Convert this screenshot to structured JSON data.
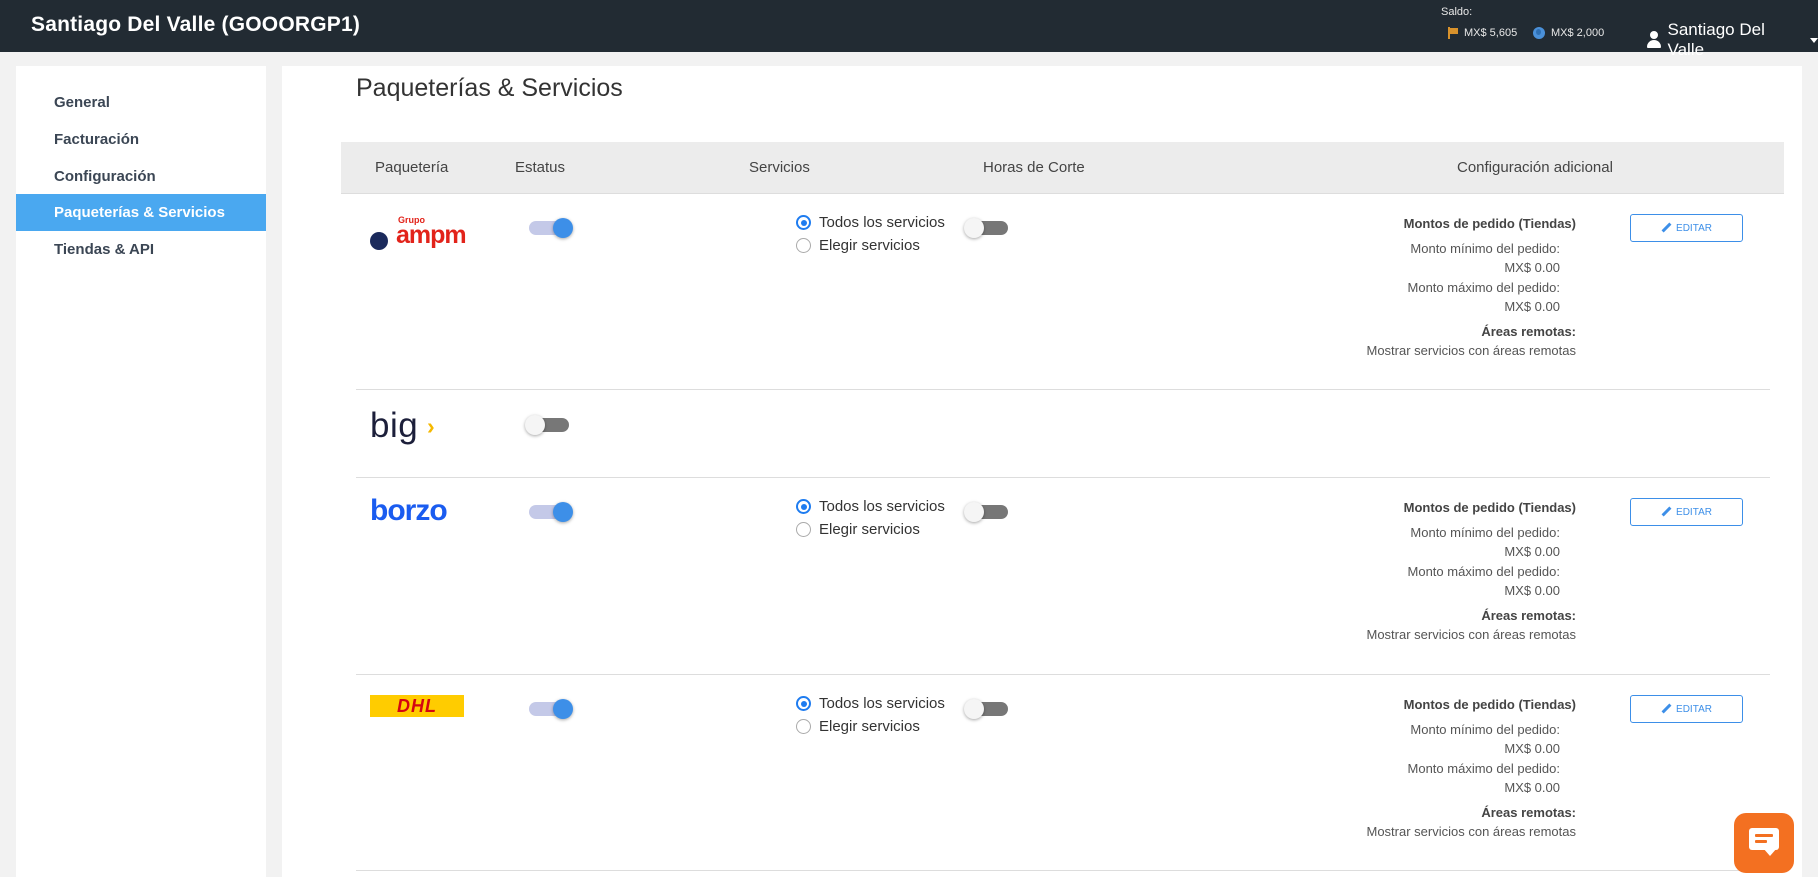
{
  "header": {
    "title": "Santiago Del Valle (GOOORGP1)",
    "saldo_label": "Saldo:",
    "balance_primary": "MX$ 5,605",
    "balance_secondary": "MX$ 2,000",
    "user_name": "Santiago Del Valle"
  },
  "sidebar": {
    "items": [
      {
        "label": "General"
      },
      {
        "label": "Facturación"
      },
      {
        "label": "Configuración"
      },
      {
        "label": "Paqueterías & Servicios"
      },
      {
        "label": "Tiendas & API"
      }
    ],
    "active_index": 3
  },
  "page": {
    "title": "Paqueterías & Servicios",
    "columns": [
      "Paquetería",
      "Estatus",
      "Servicios",
      "Horas de Corte",
      "Configuración adicional"
    ]
  },
  "carriers": [
    {
      "name": "Grupo ampm",
      "logo_text_top": "Grupo",
      "logo_text": "ampm",
      "status_on": true,
      "radio_all": "Todos los servicios",
      "radio_choose": "Elegir servicios",
      "cutoff_on": false,
      "cfg_title": "Montos de pedido (Tiendas)",
      "min_label": "Monto mínimo del pedido:",
      "min_value": "MX$ 0.00",
      "max_label": "Monto máximo del pedido:",
      "max_value": "MX$ 0.00",
      "remote_title": "Áreas remotas:",
      "remote_value": "Mostrar servicios con áreas remotas",
      "edit_label": "EDITAR"
    },
    {
      "name": "big",
      "logo_text": "big",
      "status_on": false
    },
    {
      "name": "borzo",
      "logo_text": "borzo",
      "status_on": true,
      "radio_all": "Todos los servicios",
      "radio_choose": "Elegir servicios",
      "cutoff_on": false,
      "cfg_title": "Montos de pedido (Tiendas)",
      "min_label": "Monto mínimo del pedido:",
      "min_value": "MX$ 0.00",
      "max_label": "Monto máximo del pedido:",
      "max_value": "MX$ 0.00",
      "remote_title": "Áreas remotas:",
      "remote_value": "Mostrar servicios con áreas remotas",
      "edit_label": "EDITAR"
    },
    {
      "name": "DHL",
      "logo_text": "DHL",
      "status_on": true,
      "radio_all": "Todos los servicios",
      "radio_choose": "Elegir servicios",
      "cutoff_on": false,
      "cfg_title": "Montos de pedido (Tiendas)",
      "min_label": "Monto mínimo del pedido:",
      "min_value": "MX$ 0.00",
      "max_label": "Monto máximo del pedido:",
      "max_value": "MX$ 0.00",
      "remote_title": "Áreas remotas:",
      "remote_value": "Mostrar servicios con áreas remotas",
      "edit_label": "EDITAR"
    }
  ],
  "colors": {
    "topbar": "#222b33",
    "accent": "#3d8fe8",
    "sidebar_active": "#4aa8f0",
    "chat_button": "#f37021",
    "borzo": "#1a5cf0",
    "dhl_yellow": "#ffcc00",
    "dhl_red": "#d40511",
    "ampm_red": "#e2231a",
    "ampm_navy": "#1b2a5c",
    "big_yellow": "#f5b800"
  },
  "icons": [
    "flag-icon",
    "globe-icon",
    "user-icon",
    "chevron-down-icon",
    "pencil-icon",
    "chat-icon"
  ]
}
